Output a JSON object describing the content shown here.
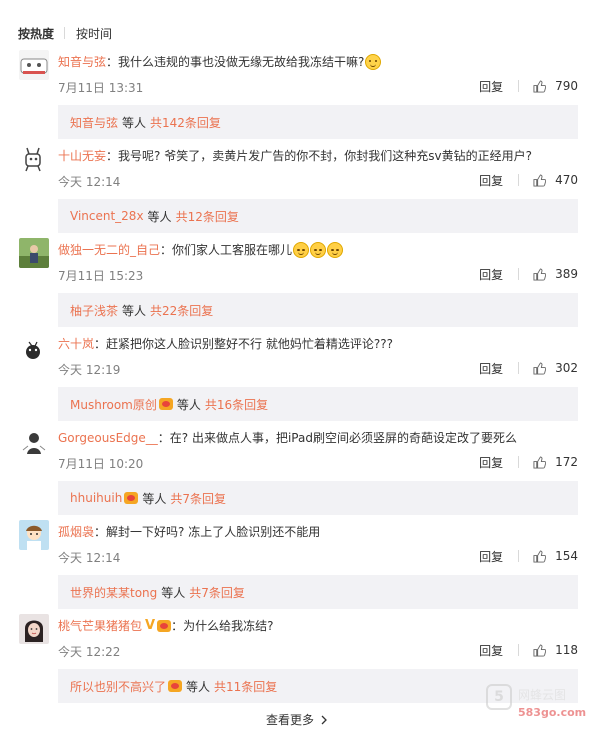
{
  "tabs": [
    {
      "label": "按热度",
      "active": true
    },
    {
      "label": "按时间",
      "active": false
    }
  ],
  "reply_label": "回复",
  "comments": [
    {
      "user": "知音与弦",
      "text": "我什么违规的事也没做无缘无故给我冻结干嘛?",
      "emoji": "smile",
      "time": "7月11日 13:31",
      "likes": "790",
      "sub_user": "知音与弦",
      "sub_mid": "等人",
      "sub_count": "共142条回复"
    },
    {
      "user": "十山无妄",
      "text": "我号呢? 爷笑了，卖黄片发广告的你不封，你封我们这种充sv黄钻的正经用户?",
      "time": "今天 12:14",
      "likes": "470",
      "sub_user": "Vincent_28x",
      "sub_mid": "等人",
      "sub_count": "共12条回复"
    },
    {
      "user": "做独一无二的_自己",
      "text": "你们家人工客服在哪儿",
      "emoji": "cry x3",
      "time": "7月11日 15:23",
      "likes": "389",
      "sub_user": "柚子浅茶",
      "sub_mid": "等人",
      "sub_count": "共22条回复"
    },
    {
      "user": "六十岚",
      "text": "赶紧把你这人脸识别整好不行 就他妈忙着精选评论???",
      "time": "今天 12:19",
      "likes": "302",
      "sub_user": "Mushroom原创",
      "sub_mid": "等人",
      "sub_count": "共16条回复"
    },
    {
      "user": "GorgeousEdge__",
      "text": "在? 出来做点人事，把iPad刷空间必须竖屏的奇葩设定改了要死么",
      "time": "7月11日 10:20",
      "likes": "172",
      "sub_user": "hhuihuih",
      "sub_mid": "等人",
      "sub_count": "共7条回复"
    },
    {
      "user": "孤烟袅",
      "text": "解封一下好吗? 冻上了人脸识别还不能用",
      "time": "今天 12:14",
      "likes": "154",
      "sub_user": "世界的某某tong",
      "sub_mid": "等人",
      "sub_count": "共7条回复"
    },
    {
      "user": "桃气芒果猪猪包",
      "badge": "V",
      "text": "为什么给我冻结?",
      "time": "今天 12:22",
      "likes": "118",
      "sub_user": "所以也别不高兴了",
      "sub_mid": "等人",
      "sub_count": "共11条回复"
    }
  ],
  "more_label": "查看更多",
  "watermark": {
    "logo": "5",
    "name": "网蜂云图",
    "url": "583go.com"
  },
  "colors": {
    "accent": "#eb7350",
    "subbox_bg": "#f2f2f5",
    "muted": "#808080"
  }
}
